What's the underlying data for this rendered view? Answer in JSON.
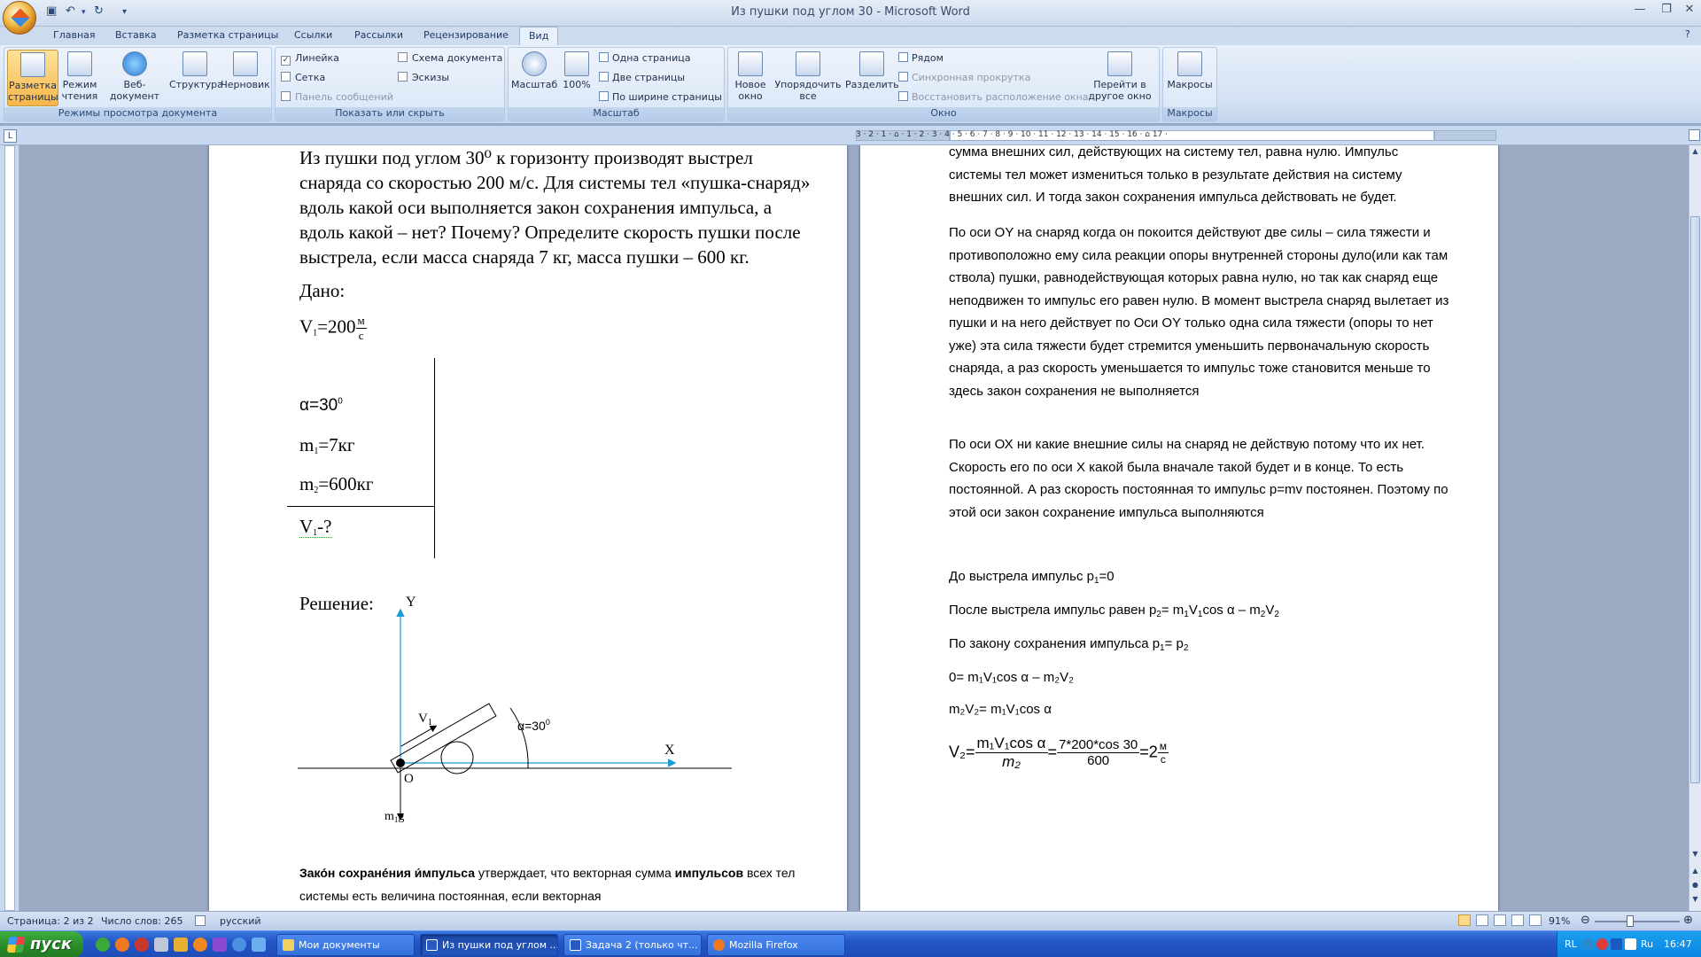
{
  "window": {
    "title": "Из пушки под углом 30 - Microsoft Word",
    "minimize_glyph": "—",
    "restore_glyph": "❐",
    "close_glyph": "✕",
    "help_glyph": "?"
  },
  "tabs": [
    "Главная",
    "Вставка",
    "Разметка страницы",
    "Ссылки",
    "Рассылки",
    "Рецензирование",
    "Вид"
  ],
  "active_tab": "Вид",
  "ribbon": {
    "groups": {
      "views": {
        "label": "Режимы просмотра документа",
        "buttons": [
          "Разметка страницы",
          "Режим чтения",
          "Веб-документ",
          "Структура",
          "Черновик"
        ]
      },
      "show": {
        "label": "Показать или скрыть",
        "ruler": "Линейка",
        "grid": "Сетка",
        "messages": "Панель сообщений",
        "docmap": "Схема документа",
        "thumbs": "Эскизы"
      },
      "zoom": {
        "label": "Масштаб",
        "zoom_btn": "Масштаб",
        "percent_btn": "100%",
        "one_page": "Одна страница",
        "two_pages": "Две страницы",
        "page_width": "По ширине страницы"
      },
      "window": {
        "label": "Окно",
        "new_window": "Новое окно",
        "arrange": "Упорядочить все",
        "split": "Разделить",
        "side_by_side": "Рядом",
        "sync_scroll": "Синхронная прокрутка",
        "reset_pos": "Восстановить расположение окна",
        "switch": "Перейти в другое окно"
      },
      "macros": {
        "label": "Макросы",
        "macros_btn": "Макросы"
      }
    }
  },
  "ruler_numbers": "3 · 2 · 1 · ⌂ · 1 · 2 · 3 · 4 · 5 · 6 · 7 · 8 · 9 · 10 · 11 · 12 · 13 · 14 · 15 · 16 · ⌂ 17 ·",
  "left_page": {
    "problem_text": "Из пушки под углом 30⁰ к горизонту производят выстрел снаряда со скоростью 200 м/с. Для системы тел «пушка-снаряд» вдоль какой оси выполняется закон сохранения импульса, а вдоль какой – нет? Почему? Определите скорость пушки после выстрела, если масса снаряда 7 кг, масса пушки – 600 кг.",
    "given_heading": "Дано:",
    "given": {
      "v1": "V",
      "v1_sub": "1",
      "v1_val": "=200",
      "v1_unit_num": "м",
      "v1_unit_den": "с",
      "alpha": "α=30",
      "alpha_sup": "0",
      "m1": "m",
      "m1_sub": "1",
      "m1_val": "=7кг",
      "m2": "m",
      "m2_sub": "2",
      "m2_val": "=600кг",
      "find": "V",
      "find_sub": "1",
      "find_val": "-?"
    },
    "solution_heading": "Решение:",
    "figure": {
      "y_label": "Y",
      "x_label": "X",
      "origin_label": "O",
      "v_label": "V",
      "v_sub": "1",
      "angle_label": "α=30",
      "angle_sup": "0",
      "gravity_label": "m",
      "gravity_sub": "1",
      "gravity_g": "g"
    },
    "law_bold1": "Зако́н сохране́ния и́мпульса",
    "law_text1": " утверждает, что векторная сумма ",
    "law_bold2": "импульсов",
    "law_text2": " всех тел системы есть величина постоянная, если векторная"
  },
  "right_page": {
    "p0_line1": "сумма внешних сил, действующих на систему тел, равна нулю. Импульс",
    "p0_line2": "системы тел может измениться только в результате действия на систему",
    "p0_line3": "внешних сил. И тогда закон сохранения импульса действовать не будет.",
    "p1": "По оси  OY на снаряд  когда он покоится действуют две силы – сила тяжести и противоположно ему сила реакции опоры внутренней стороны дуло(или как там ствола) пушки, равнодействующая которых равна нулю,  но так как снаряд еще неподвижен то импульс его равен нулю. В момент выстрела снаряд вылетает из пушки и на него действует по Оси OY только одна сила тяжести (опоры то нет уже) эта сила тяжести будет стремится уменьшить первоначальную  скорость снаряда,  а раз скорость уменьшается  то импульс тоже становится меньше то здесь закон сохранения не выполняется",
    "p2": "По оси ОХ ни какие внешние силы на снаряд не действую потому что их нет.  Скорость его по оси Х какой была вначале такой будет и в конце. То есть постоянной. А раз скорость постоянная то импульс p=mv постоянен. Поэтому по этой оси закон сохранение импульса выполняются",
    "eq1": "До выстрела импульс  p",
    "eq1_sub": "1",
    "eq1_tail": "=0",
    "eq2_a": "После выстрела импульс равен p",
    "eq2_sub1": "2",
    "eq2_b": "= m",
    "eq2_sub2": "1",
    "eq2_c": "V",
    "eq2_sub3": "1",
    "eq2_d": "cos α – m",
    "eq2_sub4": "2",
    "eq2_e": "V",
    "eq2_sub5": "2",
    "eq3_a": "По закону сохранения импульса p",
    "eq3_sub1": "1",
    "eq3_b": "= p",
    "eq3_sub2": "2",
    "eq4": "0= m₁V₁cos α – m₂V₂",
    "eq5": "m₂V₂= m₁V₁cos α",
    "final_lhs": "V₂=",
    "final_num1": "m₁V₁cos α",
    "final_den1": "m₂",
    "final_eq": "=",
    "final_num2": "7*200*cos 30",
    "final_den2": "600",
    "final_eq2": "=2",
    "final_unit_num": "м",
    "final_unit_den": "с"
  },
  "status": {
    "page": "Страница: 2 из 2",
    "words": "Число слов: 265",
    "lang": "русский",
    "zoom": "91%",
    "zoom_minus": "⊖",
    "zoom_plus": "⊕"
  },
  "taskbar": {
    "start": "пуск",
    "tasks": [
      "Мои документы",
      "Из пушки под углом ...",
      "Задача 2 (только чт...",
      "Mozilla Firefox"
    ],
    "tray_lang": "RL",
    "tray_lang2": "Ru",
    "clock": "16:47"
  }
}
